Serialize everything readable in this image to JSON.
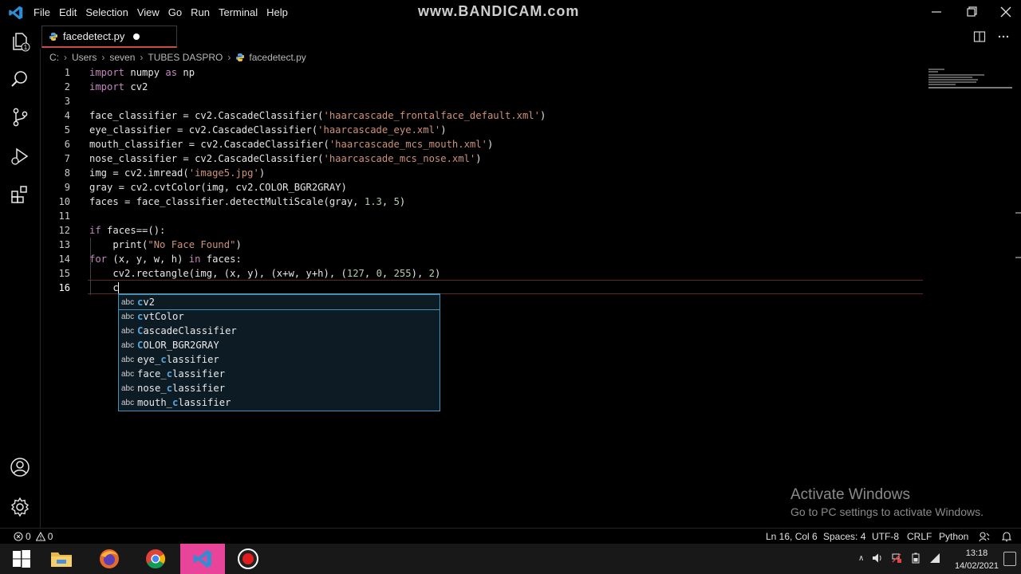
{
  "menubar": [
    "File",
    "Edit",
    "Selection",
    "View",
    "Go",
    "Run",
    "Terminal",
    "Help"
  ],
  "watermark": "www.BANDICAM.com",
  "tab": {
    "label": "facedetect.py"
  },
  "breadcrumb": [
    "C:",
    "Users",
    "seven",
    "TUBES DASPRO",
    "facedetect.py"
  ],
  "activity_badge": "1",
  "editor": {
    "line_numbers": [
      "1",
      "2",
      "3",
      "4",
      "5",
      "6",
      "7",
      "8",
      "9",
      "10",
      "11",
      "12",
      "13",
      "14",
      "15",
      "16"
    ],
    "current_line": 16
  },
  "suggestions": [
    {
      "kind": "abc",
      "label": "cv2"
    },
    {
      "kind": "abc",
      "label": "cvtColor"
    },
    {
      "kind": "abc",
      "label": "CascadeClassifier"
    },
    {
      "kind": "abc",
      "label": "COLOR_BGR2GRAY"
    },
    {
      "kind": "abc",
      "label": "eye_classifier"
    },
    {
      "kind": "abc",
      "label": "face_classifier"
    },
    {
      "kind": "abc",
      "label": "nose_classifier"
    },
    {
      "kind": "abc",
      "label": "mouth_classifier"
    }
  ],
  "activate_windows": {
    "title": "Activate Windows",
    "subtitle": "Go to PC settings to activate Windows."
  },
  "status": {
    "errors": "0",
    "warnings": "0",
    "position": "Ln 16, Col 6",
    "spaces": "Spaces: 4",
    "encoding": "UTF-8",
    "eol": "CRLF",
    "language": "Python"
  },
  "clock": {
    "time": "13:18",
    "date": "14/02/2021"
  },
  "colors": {
    "accent": "#4c8fb5",
    "tab_border": "#c94c4c",
    "keyword": "#c586c0",
    "string": "#ce9178",
    "number": "#b5cea8"
  }
}
